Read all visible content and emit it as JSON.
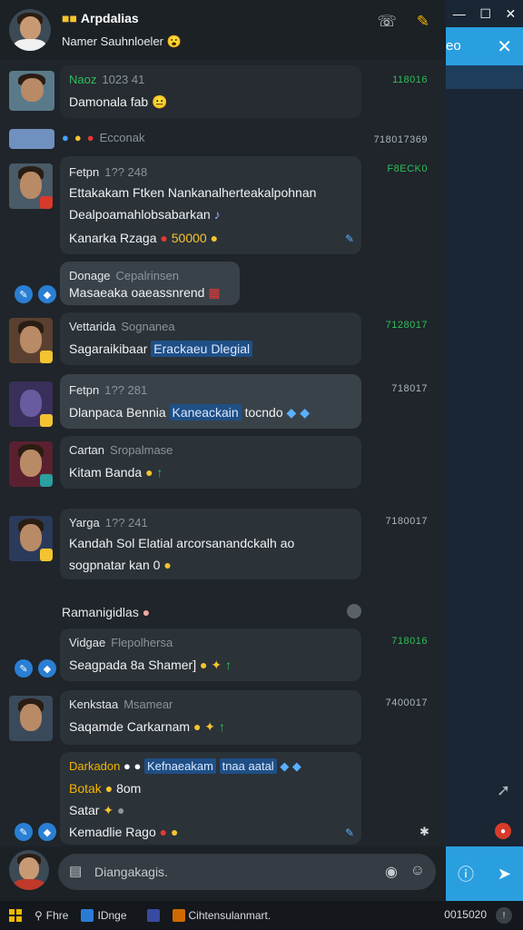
{
  "header": {
    "title": "Arpdalias",
    "subtitle": "Namer Sauhnloeler",
    "subtitle_emoji": "😮"
  },
  "bg_window": {
    "tab_text": "eo"
  },
  "messages": [
    {
      "name": "Naoz",
      "meta": "1023 41",
      "text": "Damonala fab",
      "emoji": "😐",
      "time": "118016"
    },
    {
      "name": "",
      "meta": "Ecconak",
      "text": "",
      "time": "718017369"
    },
    {
      "name": "Fetpn",
      "meta": "1?? 248",
      "text_1": "Ettakakam Ftken Nankanalherteakalpohnan",
      "text_2": "Dealpoamahlobsabarkan",
      "text_3": "Kanarka Rzaga",
      "value": "50000",
      "time": "F8ECK0"
    },
    {
      "name": "Donage",
      "meta": "Cepalrinsen",
      "text": "Masaeaka oaeassnrend"
    },
    {
      "name": "Vettarida",
      "meta": "Sognanea",
      "text": "Sagaraikibaar",
      "link": "Erackaeu Dlegial",
      "time": "7128017"
    },
    {
      "name": "Fetpn",
      "meta": "1?? 281",
      "text": "Dlanpaca Bennia",
      "link": "Kaneackain",
      "text_after": "tocndo",
      "time": "718017"
    },
    {
      "name": "Cartan",
      "meta": "Sropalmase",
      "text": "Kitam Banda"
    },
    {
      "name": "Yarga",
      "meta": "1?? 241",
      "text_1": "Kandah Sol Elatial arcorsanandckalh ao",
      "text_2": "sogpnatar kan",
      "value": "0",
      "time": "7180017"
    },
    {
      "name": "Vidgae",
      "meta": "Flepolhersa",
      "text": "Seagpada 8a Shamer]",
      "time": "718016"
    },
    {
      "name": "Kenkstaa",
      "meta": "Msamear",
      "text": "Saqamde Carkarnam",
      "time": "7400017"
    },
    {
      "name": "Darkadon",
      "link": "Kefnaeakam",
      "text_link_after": "tnaa aatal",
      "line_2": "Botak",
      "line_2_val": "8om",
      "line_3": "Satar",
      "line_4": "Kemadlie Rago"
    }
  ],
  "separator": {
    "label": "Ramanigidlas"
  },
  "compose": {
    "placeholder": "Diangakagis."
  },
  "taskbar": {
    "item_1": "Fhre",
    "item_2": "IDnge",
    "item_3": "Cihtensulanmart.",
    "time": "0015020"
  },
  "colors": {
    "accent": "#2a9fe0",
    "time_green": "#2fbf5a",
    "bubble": "#2b3238",
    "link_bg": "#1f4f86"
  }
}
